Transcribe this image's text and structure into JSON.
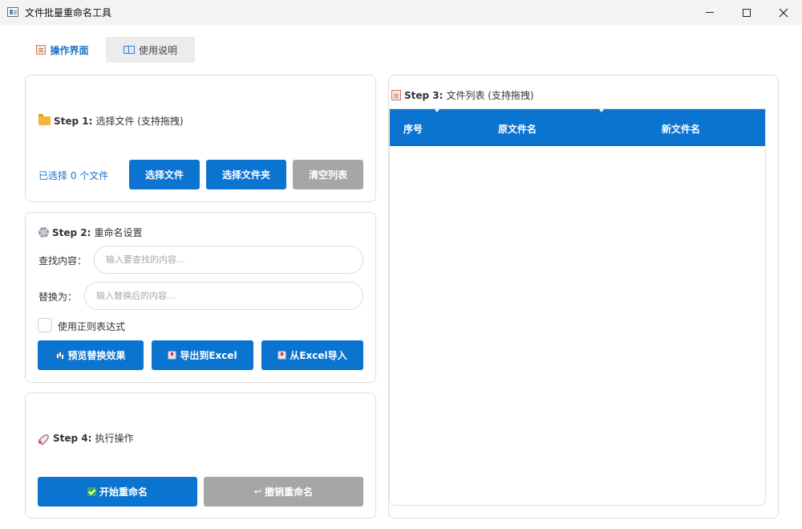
{
  "window": {
    "title": "文件批量重命名工具"
  },
  "tabs": [
    {
      "label": "操作界面",
      "icon": "clipboard-icon",
      "active": true
    },
    {
      "label": "使用说明",
      "icon": "book-icon",
      "active": false
    }
  ],
  "step1": {
    "title_bold": "Step 1:",
    "title_text": "选择文件 (支持拖拽)",
    "icon": "folder-icon",
    "selected_count_text": "已选择 0 个文件",
    "buttons": {
      "select_files": "选择文件",
      "select_folder": "选择文件夹",
      "clear_list": "清空列表"
    }
  },
  "step2": {
    "title_bold": "Step 2:",
    "title_text": "重命名设置",
    "icon": "gear-icon",
    "find_label": "查找内容：",
    "find_placeholder": "输入要查找的内容...",
    "find_value": "",
    "replace_label": "替换为：",
    "replace_placeholder": "输入替换后的内容...",
    "replace_value": "",
    "regex_label": "使用正则表达式",
    "regex_checked": false,
    "buttons": {
      "preview": "预览替换效果",
      "export_excel": "导出到Excel",
      "import_excel": "从Excel导入"
    }
  },
  "step3": {
    "title_bold": "Step 3:",
    "title_text": "文件列表 (支持拖拽)",
    "icon": "clipboard-icon",
    "columns": [
      "序号",
      "原文件名",
      "新文件名"
    ],
    "rows": []
  },
  "step4": {
    "title_bold": "Step 4:",
    "title_text": "执行操作",
    "icon": "rocket-icon",
    "buttons": {
      "start_rename": "开始重命名",
      "undo_rename": "撤销重命名"
    }
  },
  "colors": {
    "accent": "#0a74d0",
    "disabled": "#a6a6a6",
    "tab_active_text": "#1a73c6"
  }
}
